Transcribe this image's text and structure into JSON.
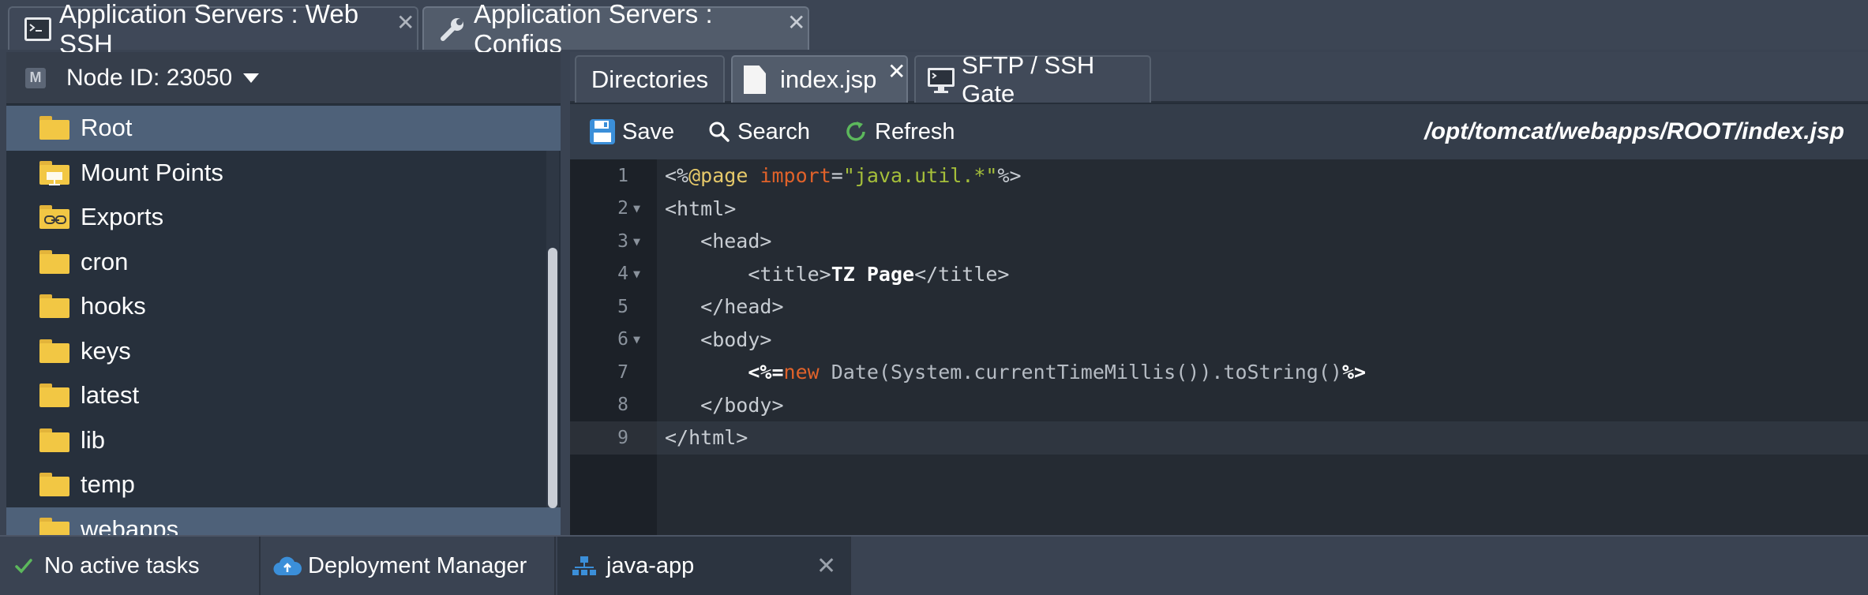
{
  "top_tabs": [
    {
      "label": "Application Servers : Web SSH",
      "icon": "terminal-icon",
      "active": false
    },
    {
      "label": "Application Servers : Configs",
      "icon": "wrench-icon",
      "active": true
    }
  ],
  "left_panel": {
    "node_badge": "M",
    "node_label": "Node ID: 23050",
    "tree": [
      {
        "label": "Root",
        "icon": "folder-icon",
        "selected": true
      },
      {
        "label": "Mount Points",
        "icon": "mount-folder-icon"
      },
      {
        "label": "Exports",
        "icon": "export-folder-icon"
      },
      {
        "label": "cron",
        "icon": "folder-icon"
      },
      {
        "label": "hooks",
        "icon": "folder-icon"
      },
      {
        "label": "keys",
        "icon": "folder-icon"
      },
      {
        "label": "latest",
        "icon": "folder-icon"
      },
      {
        "label": "lib",
        "icon": "folder-icon"
      },
      {
        "label": "temp",
        "icon": "folder-icon"
      },
      {
        "label": "webapps",
        "icon": "folder-icon",
        "selected": true
      }
    ]
  },
  "editor_tabs": [
    {
      "label": "Directories"
    },
    {
      "label": "index.jsp",
      "icon": "file-icon",
      "active": true
    },
    {
      "label": "SFTP / SSH Gate",
      "icon": "monitor-icon"
    }
  ],
  "toolbar": {
    "save_label": "Save",
    "search_label": "Search",
    "refresh_label": "Refresh",
    "file_path": "/opt/tomcat/webapps/ROOT/index.jsp"
  },
  "code": {
    "lines": [
      {
        "num": "1",
        "fold": false,
        "text": "<%@page import=\"java.util.*\"%>"
      },
      {
        "num": "2",
        "fold": true,
        "text": "<html>"
      },
      {
        "num": "3",
        "fold": true,
        "text": "   <head>"
      },
      {
        "num": "4",
        "fold": true,
        "text": "       <title>TZ Page</title>"
      },
      {
        "num": "5",
        "fold": false,
        "text": "   </head>"
      },
      {
        "num": "6",
        "fold": true,
        "text": "   <body>"
      },
      {
        "num": "7",
        "fold": false,
        "text": "       <%=new Date(System.currentTimeMillis()).toString()%>"
      },
      {
        "num": "8",
        "fold": false,
        "text": "   </body>"
      },
      {
        "num": "9",
        "fold": false,
        "text": "</html>",
        "active": true
      }
    ],
    "fold_glyph": "▼"
  },
  "status_bar": {
    "tasks_label": "No active tasks",
    "deploy_label": "Deployment Manager",
    "app_label": "java-app"
  },
  "colors": {
    "accent_green": "#5cb85c",
    "folder_yellow": "#f2c744",
    "keyword": "#e0622a",
    "string": "#a5bf3a",
    "directive": "#e6c96a"
  },
  "close_glyph": "✕"
}
